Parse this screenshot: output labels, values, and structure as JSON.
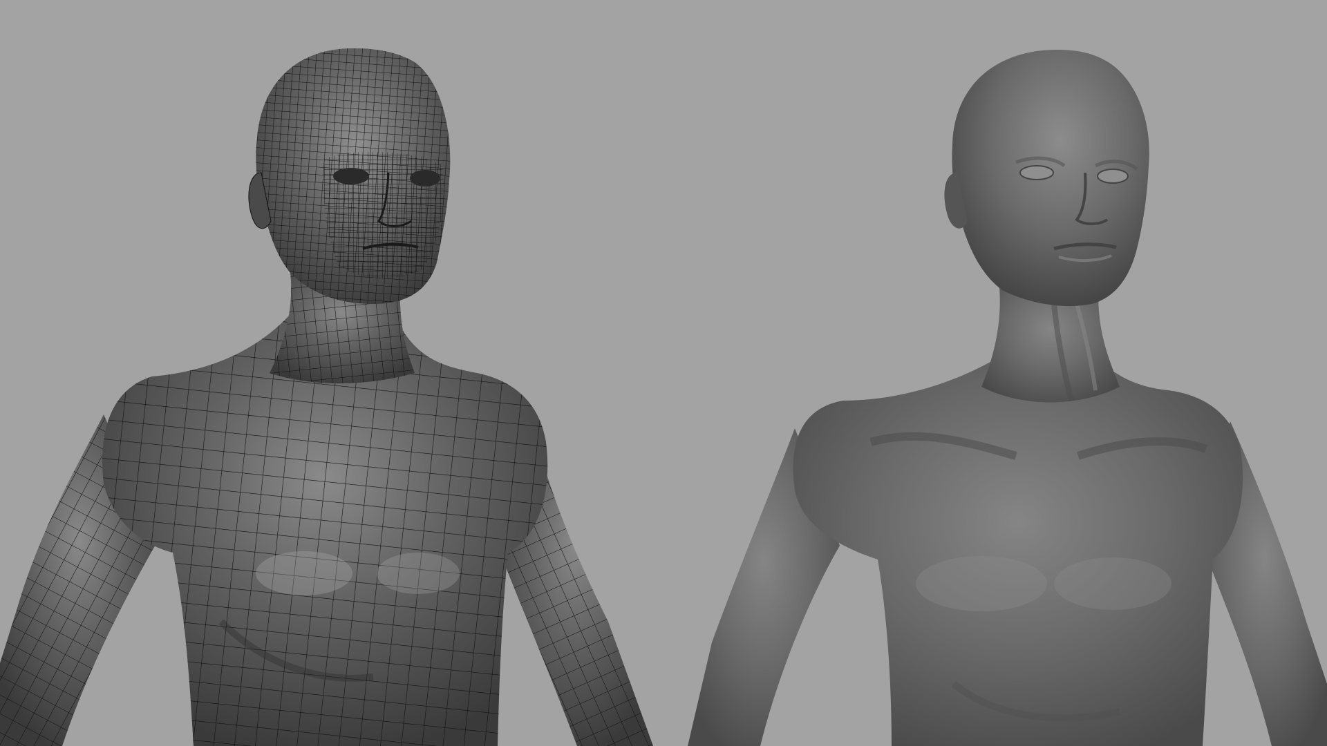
{
  "scene": {
    "background_color": "#a3a3a3",
    "mesh_fill_color": "#5c5c5c",
    "wire_color": "#111111",
    "sculpt_fill_color": "#676767",
    "models": [
      {
        "name": "wireframe-bust",
        "display": "wireframe-on-shaded"
      },
      {
        "name": "smooth-bust",
        "display": "smooth-shaded"
      }
    ]
  }
}
